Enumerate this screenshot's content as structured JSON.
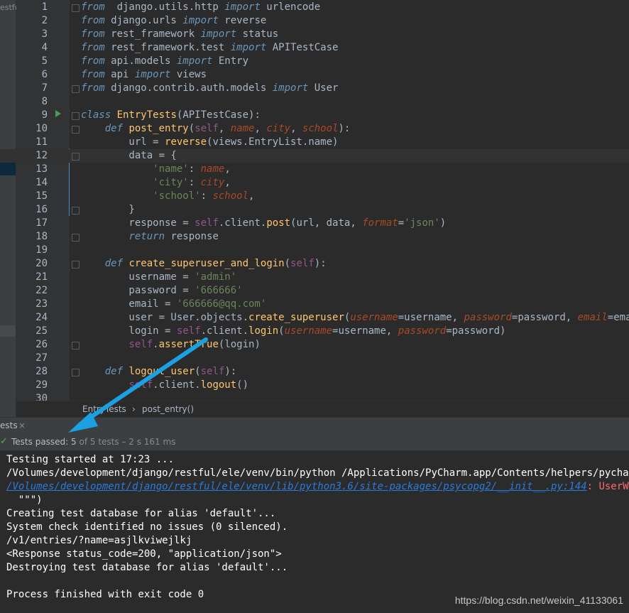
{
  "project_label": "estfu",
  "lines": [
    {
      "n": "1",
      "parts": [
        [
          "imp",
          "from"
        ],
        [
          "",
          "  django.utils.http "
        ],
        [
          "imp",
          "import"
        ],
        [
          "",
          " urlencode"
        ]
      ]
    },
    {
      "n": "2",
      "parts": [
        [
          "imp",
          "from"
        ],
        [
          "",
          " django.urls "
        ],
        [
          "imp",
          "import"
        ],
        [
          "",
          " reverse"
        ]
      ]
    },
    {
      "n": "3",
      "parts": [
        [
          "imp",
          "from"
        ],
        [
          "",
          " rest_framework "
        ],
        [
          "imp",
          "import"
        ],
        [
          "",
          " status"
        ]
      ]
    },
    {
      "n": "4",
      "parts": [
        [
          "imp",
          "from"
        ],
        [
          "",
          " rest_framework.test "
        ],
        [
          "imp",
          "import"
        ],
        [
          "",
          " APITestCase"
        ]
      ]
    },
    {
      "n": "5",
      "parts": [
        [
          "imp",
          "from"
        ],
        [
          "",
          " api.models "
        ],
        [
          "imp",
          "import"
        ],
        [
          "",
          " Entry"
        ]
      ]
    },
    {
      "n": "6",
      "parts": [
        [
          "imp",
          "from"
        ],
        [
          "",
          " api "
        ],
        [
          "imp",
          "import"
        ],
        [
          "",
          " views"
        ]
      ]
    },
    {
      "n": "7",
      "parts": [
        [
          "imp",
          "from"
        ],
        [
          "",
          " django.contrib.auth.models "
        ],
        [
          "imp",
          "import"
        ],
        [
          "",
          " User"
        ]
      ]
    },
    {
      "n": "8",
      "parts": []
    },
    {
      "n": "9",
      "parts": [
        [
          "cls-kw",
          "class"
        ],
        [
          "",
          " "
        ],
        [
          "fn",
          "EntryTests"
        ],
        [
          "",
          "(APITestCase):"
        ]
      ]
    },
    {
      "n": "10",
      "parts": [
        [
          "",
          "    "
        ],
        [
          "cls-kw",
          "def"
        ],
        [
          "",
          " "
        ],
        [
          "fn",
          "post_entry"
        ],
        [
          "",
          "("
        ],
        [
          "slf",
          "self"
        ],
        [
          "",
          ", "
        ],
        [
          "prm",
          "name"
        ],
        [
          "",
          ", "
        ],
        [
          "prm",
          "city"
        ],
        [
          "",
          ", "
        ],
        [
          "prm",
          "school"
        ],
        [
          "",
          "):"
        ]
      ]
    },
    {
      "n": "11",
      "parts": [
        [
          "",
          "        url = "
        ],
        [
          "fn",
          "reverse"
        ],
        [
          "",
          "(views.EntryList.name)"
        ]
      ]
    },
    {
      "n": "12",
      "parts": [
        [
          "",
          "        data = {"
        ]
      ]
    },
    {
      "n": "13",
      "parts": [
        [
          "",
          "            "
        ],
        [
          "str",
          "'name'"
        ],
        [
          "",
          ": "
        ],
        [
          "prm",
          "name"
        ],
        [
          "",
          ","
        ]
      ]
    },
    {
      "n": "14",
      "parts": [
        [
          "",
          "            "
        ],
        [
          "str",
          "'city'"
        ],
        [
          "",
          ": "
        ],
        [
          "prm",
          "city"
        ],
        [
          "",
          ","
        ]
      ]
    },
    {
      "n": "15",
      "parts": [
        [
          "",
          "            "
        ],
        [
          "str",
          "'school'"
        ],
        [
          "",
          ": "
        ],
        [
          "prm",
          "school"
        ],
        [
          "",
          ","
        ]
      ]
    },
    {
      "n": "16",
      "parts": [
        [
          "",
          "        }"
        ]
      ]
    },
    {
      "n": "17",
      "parts": [
        [
          "",
          "        response = "
        ],
        [
          "slf",
          "self"
        ],
        [
          "",
          ".client."
        ],
        [
          "fn",
          "post"
        ],
        [
          "",
          "(url, data, "
        ],
        [
          "prm",
          "format"
        ],
        [
          "",
          "="
        ],
        [
          "str",
          "'json'"
        ],
        [
          "",
          ")"
        ]
      ]
    },
    {
      "n": "18",
      "parts": [
        [
          "",
          "        "
        ],
        [
          "cls-kw",
          "return"
        ],
        [
          "",
          " response"
        ]
      ]
    },
    {
      "n": "19",
      "parts": []
    },
    {
      "n": "20",
      "parts": [
        [
          "",
          "    "
        ],
        [
          "cls-kw",
          "def"
        ],
        [
          "",
          " "
        ],
        [
          "fn",
          "create_superuser_and_login"
        ],
        [
          "",
          "("
        ],
        [
          "slf",
          "self"
        ],
        [
          "",
          "):"
        ]
      ]
    },
    {
      "n": "21",
      "parts": [
        [
          "",
          "        username = "
        ],
        [
          "str",
          "'admin'"
        ]
      ]
    },
    {
      "n": "22",
      "parts": [
        [
          "",
          "        password = "
        ],
        [
          "str",
          "'666666'"
        ]
      ]
    },
    {
      "n": "23",
      "parts": [
        [
          "",
          "        email = "
        ],
        [
          "str",
          "'666666@qq.com'"
        ]
      ]
    },
    {
      "n": "24",
      "parts": [
        [
          "",
          "        user = User.objects."
        ],
        [
          "fn",
          "create_superuser"
        ],
        [
          "",
          "("
        ],
        [
          "prm",
          "username"
        ],
        [
          "",
          "=username, "
        ],
        [
          "prm",
          "password"
        ],
        [
          "",
          "=password, "
        ],
        [
          "prm",
          "email"
        ],
        [
          "",
          "=email)"
        ]
      ]
    },
    {
      "n": "25",
      "parts": [
        [
          "",
          "        login = "
        ],
        [
          "slf",
          "self"
        ],
        [
          "",
          ".client."
        ],
        [
          "fn",
          "login"
        ],
        [
          "",
          "("
        ],
        [
          "prm",
          "username"
        ],
        [
          "",
          "=username, "
        ],
        [
          "prm",
          "password"
        ],
        [
          "",
          "=password)"
        ]
      ]
    },
    {
      "n": "26",
      "parts": [
        [
          "",
          "        "
        ],
        [
          "slf",
          "self"
        ],
        [
          "",
          "."
        ],
        [
          "fn",
          "assertTrue"
        ],
        [
          "",
          "(login)"
        ]
      ]
    },
    {
      "n": "27",
      "parts": []
    },
    {
      "n": "28",
      "parts": [
        [
          "",
          "    "
        ],
        [
          "cls-kw",
          "def"
        ],
        [
          "",
          " "
        ],
        [
          "fn",
          "logout_user"
        ],
        [
          "",
          "("
        ],
        [
          "slf",
          "self"
        ],
        [
          "",
          "):"
        ]
      ]
    },
    {
      "n": "29",
      "parts": [
        [
          "",
          "        "
        ],
        [
          "slf",
          "self"
        ],
        [
          "",
          ".client."
        ],
        [
          "fn",
          "logout"
        ],
        [
          "",
          "()"
        ]
      ]
    },
    {
      "n": "30",
      "parts": []
    }
  ],
  "breadcrumb": {
    "class_name": "EntryTests",
    "sep": "›",
    "method": "post_entry()"
  },
  "tool_window": {
    "tab_label": "ests",
    "close": "×"
  },
  "status": {
    "check": "✓",
    "label": "Tests passed:",
    "passed": "5",
    "rest": "of 5 tests – 2 s 161 ms"
  },
  "console": [
    {
      "text": "Testing started at 17:23 ...",
      "kind": "plain"
    },
    {
      "text": "/Volumes/development/django/restful/ele/venv/bin/python /Applications/PyCharm.app/Contents/helpers/pycharm/django",
      "kind": "plain"
    },
    {
      "text": "/Volumes/development/django/restful/ele/venv/lib/python3.6/site-packages/psycopg2/__init__.py:144",
      "kind": "link",
      "suffix": ": UserWarning"
    },
    {
      "text": "  \"\"\")",
      "kind": "plain"
    },
    {
      "text": "Creating test database for alias 'default'...",
      "kind": "plain"
    },
    {
      "text": "System check identified no issues (0 silenced).",
      "kind": "plain"
    },
    {
      "text": "/v1/entries/?name=asjlkviwejlkj",
      "kind": "plain"
    },
    {
      "text": "<Response status_code=200, \"application/json\">",
      "kind": "plain"
    },
    {
      "text": "Destroying test database for alias 'default'...",
      "kind": "plain"
    },
    {
      "text": "",
      "kind": "plain"
    },
    {
      "text": "Process finished with exit code 0",
      "kind": "plain"
    }
  ],
  "watermark": "https://blog.csdn.net/weixin_41133061",
  "colors": {
    "accent_arrow": "#1ba1e2",
    "pass_green": "#5fb33e"
  }
}
